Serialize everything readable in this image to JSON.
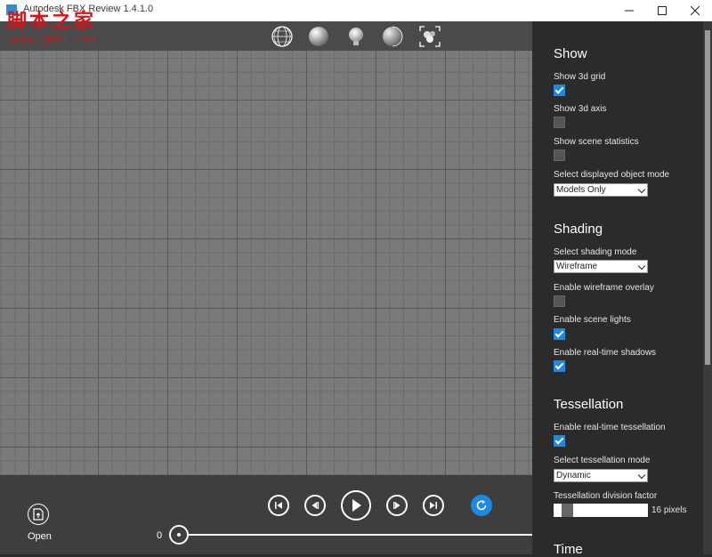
{
  "window": {
    "title": "Autodesk FBX Review 1.4.1.0",
    "watermark_cn": "脚本之家",
    "watermark_url": "www.jb51.net"
  },
  "toolbar": {
    "icons": [
      "wireframe-sphere-icon",
      "solid-sphere-icon",
      "light-bulb-icon",
      "shaded-sphere-icon",
      "frame-scene-icon"
    ]
  },
  "bottom": {
    "open_label": "Open",
    "time_value": "0"
  },
  "panel": {
    "show": {
      "heading": "Show",
      "grid_label": "Show 3d grid",
      "grid_checked": true,
      "axis_label": "Show 3d axis",
      "axis_checked": false,
      "stats_label": "Show scene statistics",
      "stats_checked": false,
      "mode_label": "Select displayed object mode",
      "mode_value": "Models Only"
    },
    "shading": {
      "heading": "Shading",
      "mode_label": "Select shading mode",
      "mode_value": "Wireframe",
      "overlay_label": "Enable wireframe overlay",
      "overlay_checked": false,
      "lights_label": "Enable scene lights",
      "lights_checked": true,
      "shadows_label": "Enable real-time shadows",
      "shadows_checked": true
    },
    "tessellation": {
      "heading": "Tessellation",
      "enable_label": "Enable real-time tessellation",
      "enable_checked": true,
      "mode_label": "Select tessellation mode",
      "mode_value": "Dynamic",
      "factor_label": "Tessellation division factor",
      "factor_value": "16 pixels"
    },
    "time": {
      "heading": "Time"
    }
  },
  "colors": {
    "accent": "#1e88e5",
    "panel_bg": "#2b2b2b",
    "viewport_bg": "#7a7a7a"
  }
}
